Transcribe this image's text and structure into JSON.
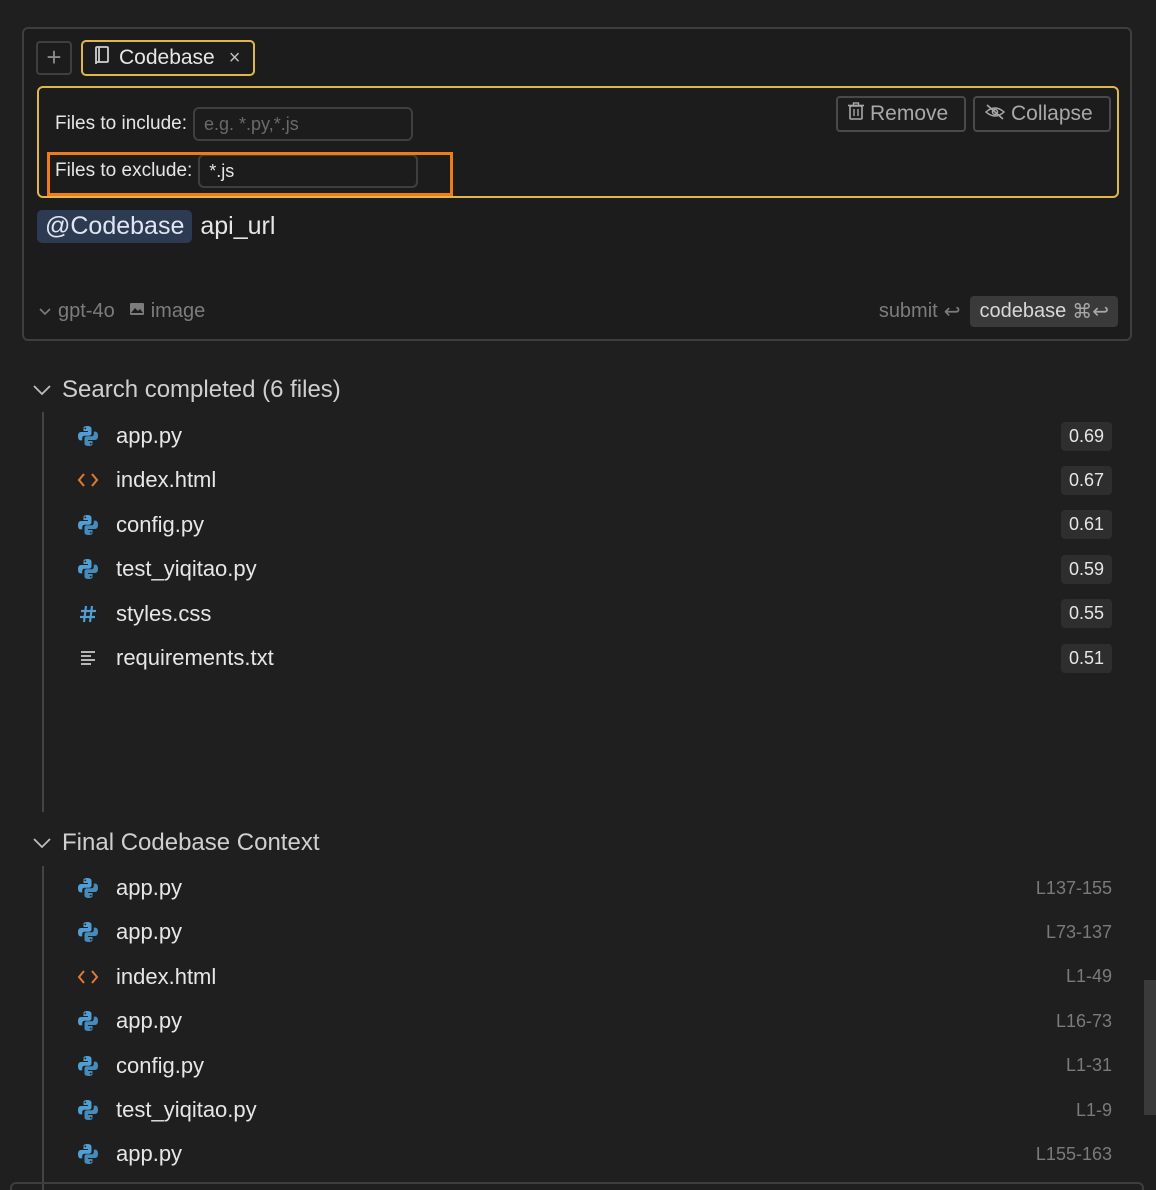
{
  "composer": {
    "add_label": "+",
    "context_tab": {
      "label": "Codebase",
      "close": "×"
    },
    "filters": {
      "include_label": "Files to include:",
      "include_placeholder": "e.g. *.py,*.js",
      "include_value": "",
      "exclude_label": "Files to exclude:",
      "exclude_value": "*.js",
      "remove_label": "Remove",
      "collapse_label": "Collapse"
    },
    "query": {
      "mention": "@Codebase",
      "text": "api_url"
    },
    "model": "gpt-4o",
    "image_label": "image",
    "submit_label": "submit",
    "submit_shortcut": "↩",
    "codebase_label": "codebase",
    "codebase_shortcut": "⌘↩"
  },
  "search": {
    "title": "Search completed (6 files)",
    "files": [
      {
        "name": "app.py",
        "icon": "python-icon",
        "score": "0.69"
      },
      {
        "name": "index.html",
        "icon": "html-icon",
        "score": "0.67"
      },
      {
        "name": "config.py",
        "icon": "python-icon",
        "score": "0.61"
      },
      {
        "name": "test_yiqitao.py",
        "icon": "python-icon",
        "score": "0.59"
      },
      {
        "name": "styles.css",
        "icon": "css-icon",
        "score": "0.55"
      },
      {
        "name": "requirements.txt",
        "icon": "text-file-icon",
        "score": "0.51"
      }
    ]
  },
  "final": {
    "title": "Final Codebase Context",
    "files": [
      {
        "name": "app.py",
        "icon": "python-icon",
        "lines": "L137-155"
      },
      {
        "name": "app.py",
        "icon": "python-icon",
        "lines": "L73-137"
      },
      {
        "name": "index.html",
        "icon": "html-icon",
        "lines": "L1-49"
      },
      {
        "name": "app.py",
        "icon": "python-icon",
        "lines": "L16-73"
      },
      {
        "name": "config.py",
        "icon": "python-icon",
        "lines": "L1-31"
      },
      {
        "name": "test_yiqitao.py",
        "icon": "python-icon",
        "lines": "L1-9"
      },
      {
        "name": "app.py",
        "icon": "python-icon",
        "lines": "L155-163"
      }
    ]
  },
  "colors": {
    "accent_border": "#e0b74a",
    "highlight": "#f07c16",
    "mention_bg": "#2c3a52",
    "python_blue": "#4f9fd6",
    "html_orange": "#e37933",
    "css_blue": "#4f9fd6"
  }
}
